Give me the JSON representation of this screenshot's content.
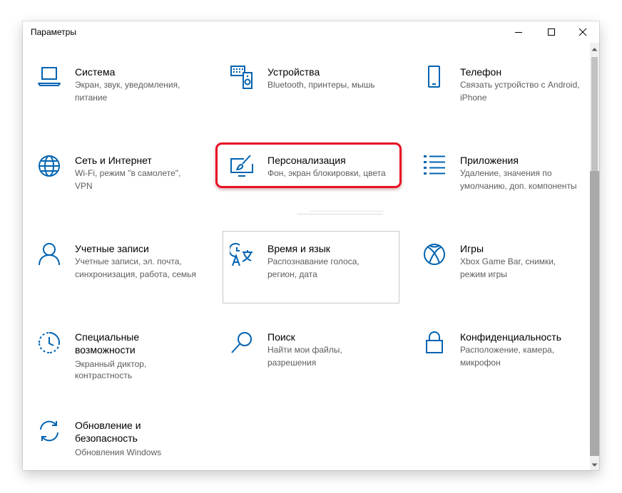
{
  "window": {
    "title": "Параметры"
  },
  "colors": {
    "accent": "#0063b1",
    "highlight_border": "#e81123",
    "text_primary": "#000000",
    "text_secondary": "#5d5d5d"
  },
  "tiles": [
    {
      "id": "system",
      "icon": "laptop-icon",
      "name": "Система",
      "desc": [
        "Экран, звук, уведомления,",
        "питание"
      ]
    },
    {
      "id": "devices",
      "icon": "keyboard-speaker-icon",
      "name": "Устройства",
      "desc": [
        "Bluetooth, принтеры, мышь",
        ""
      ]
    },
    {
      "id": "phone",
      "icon": "phone-icon",
      "name": "Телефон",
      "desc": [
        "Связать устройство с Android,",
        "iPhone"
      ]
    },
    {
      "id": "network",
      "icon": "globe-icon",
      "name": "Сеть и Интернет",
      "desc": [
        "Wi-Fi, режим \"в самолете\",",
        "VPN"
      ]
    },
    {
      "id": "personalization",
      "icon": "paintbrush-monitor-icon",
      "name": "Персонализация",
      "desc": [
        "Фон, экран блокировки, цвета",
        ""
      ]
    },
    {
      "id": "apps",
      "icon": "apps-list-icon",
      "name": "Приложения",
      "desc": [
        "Удаление, значения по",
        "умолчанию, доп. компоненты"
      ]
    },
    {
      "id": "accounts",
      "icon": "person-icon",
      "name": "Учетные записи",
      "desc": [
        "Учетные записи, эл. почта,",
        "синхронизация, работа, семья"
      ]
    },
    {
      "id": "time",
      "icon": "time-language-icon",
      "name": "Время и язык",
      "desc": [
        "Распознавание голоса,",
        "регион, дата"
      ]
    },
    {
      "id": "gaming",
      "icon": "xbox-icon",
      "name": "Игры",
      "desc": [
        "Xbox Game Bar, снимки,",
        "режим игры"
      ]
    },
    {
      "id": "ease",
      "icon": "ease-of-access-icon",
      "name": "Специальные",
      "name2": "возможности",
      "desc": [
        "Экранный диктор,",
        "контрастность"
      ]
    },
    {
      "id": "search",
      "icon": "search-icon",
      "name": "Поиск",
      "desc": [
        "Найти мои файлы,",
        "разрешения"
      ]
    },
    {
      "id": "privacy",
      "icon": "lock-icon",
      "name": "Конфиденциальность",
      "desc": [
        "Расположение, камера,",
        "микрофон"
      ]
    },
    {
      "id": "update",
      "icon": "sync-arrows-icon",
      "name": "Обновление и",
      "name2": "безопасность",
      "desc": [
        "Обновления Windows",
        ""
      ]
    }
  ]
}
